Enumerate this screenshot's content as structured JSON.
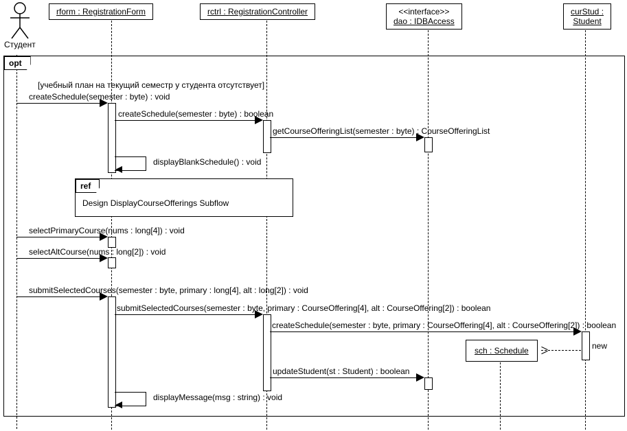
{
  "diagram_type": "UML Sequence Diagram",
  "actor": {
    "label": "Студент"
  },
  "lifelines": {
    "rform": {
      "header_top": "rform : RegistrationForm"
    },
    "rctrl": {
      "header_top": "rctrl : RegistrationController"
    },
    "dao": {
      "header_top": "<<interface>>",
      "header_bottom": "dao : IDBAccess"
    },
    "curStud": {
      "header_top": "curStud :",
      "header_bottom": "Student"
    },
    "sch": {
      "header": "sch : Schedule"
    }
  },
  "fragments": {
    "opt": {
      "label": "opt",
      "guard": "[учебный план на текущий семестр у студента отсутствует]"
    },
    "ref": {
      "label": "ref",
      "text": "Design DisplayCourseOfferings Subflow"
    }
  },
  "messages": {
    "m1": "createSchedule(semester : byte) : void",
    "m2": "createSchedule(semester : byte) : boolean",
    "m3": "getCourseOfferingList(semester : byte) : CourseOfferingList",
    "m4": "displayBlankSchedule() : void",
    "m5": "selectPrimaryCourse(nums : long[4]) : void",
    "m6": "selectAltCourse(nums : long[2]) : void",
    "m7": "submitSelectedCourses(semester : byte, primary : long[4], alt : long[2]) : void",
    "m8": "submitSelectedCourses(semester : byte, primary : CourseOffering[4], alt : CourseOffering[2]) : boolean",
    "m9": "createSchedule(semester : byte, primary : CourseOffering[4], alt : CourseOffering[2]) : boolean",
    "m10": "new",
    "m11": "updateStudent(st : Student) : boolean",
    "m12": "displayMessage(msg : string) : void"
  }
}
